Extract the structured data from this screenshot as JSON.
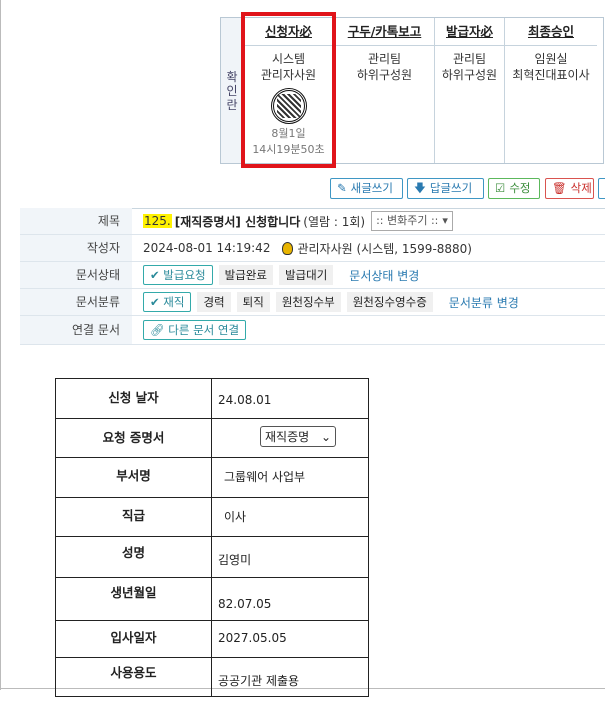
{
  "approval": {
    "side_label": [
      "확",
      "인",
      "란"
    ],
    "columns": [
      {
        "header": "신청자必",
        "line1": "시스템",
        "line2": "관리자사원",
        "stamp": "seal-stamp",
        "date": "8월1일",
        "time": "14시19분50초"
      },
      {
        "header": "구두/카톡보고",
        "line1": "관리팀",
        "line2": "하위구성원"
      },
      {
        "header": "발급자必",
        "line1": "관리팀",
        "line2": "하위구성원"
      },
      {
        "header": "최종승인",
        "line1": "임원실",
        "line2": "최혁진대표이사"
      }
    ]
  },
  "toolbar": {
    "new": "새글쓰기",
    "reply": "답글쓰기",
    "edit": "수정",
    "delete": "삭제"
  },
  "info": {
    "subject": {
      "label": "제목",
      "number": "125.",
      "title": "[재직증명서] 신청합니다",
      "views": "(열람 : 1회)",
      "select": ":: 변화주기 ::"
    },
    "author": {
      "label": "작성자",
      "datetime": "2024-08-01 14:19:42",
      "name": "관리자사원 (시스템, 1599-8880)"
    },
    "status": {
      "label": "문서상태",
      "options": [
        "발급요청",
        "발급완료",
        "발급대기"
      ],
      "change": "문서상태 변경"
    },
    "category": {
      "label": "문서분류",
      "options": [
        "재직",
        "경력",
        "퇴직",
        "원천징수부",
        "원천징수영수증"
      ],
      "change": "문서분류 변경"
    },
    "linked": {
      "label": "연결 문서",
      "button": "다른 문서 연결"
    }
  },
  "form": {
    "rows": [
      {
        "label": "신청 날자",
        "value": "24.08.01"
      },
      {
        "label": "요청 증명서",
        "select": "재직증명"
      },
      {
        "label": "부서명",
        "value": "그룹웨어 사업부"
      },
      {
        "label": "직급",
        "value": "이사"
      },
      {
        "label": "성명",
        "value": "김영미"
      },
      {
        "label": "생년월일",
        "value": "82.07.05"
      },
      {
        "label": "입사일자",
        "value": "2027.05.05"
      },
      {
        "label": "사용용도",
        "value": "공공기관 제출용"
      }
    ]
  },
  "colors": {
    "accent": "#3f97c4",
    "highlight": "#e0141a",
    "delete": "#d9534f",
    "edit": "#5cb85c",
    "number_bg": "#fff200"
  }
}
